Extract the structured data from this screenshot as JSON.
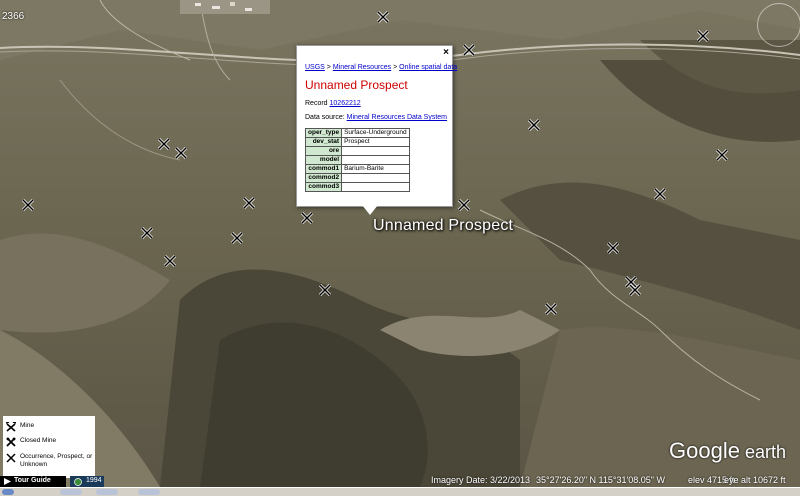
{
  "map": {
    "coord_fragment": "2366",
    "place_label": "Unnamed Prospect",
    "terrain_colors": {
      "base": "#6b6650",
      "ridge": "#4a4636",
      "valley": "#8a8470",
      "road": "#c8c4b6"
    }
  },
  "balloon": {
    "close_label": "×",
    "crumbs": {
      "link1": "USGS",
      "sep1": " > ",
      "link2": "Mineral Resources",
      "sep2": " > ",
      "link3": "Online spatial data"
    },
    "title": "Unnamed Prospect",
    "record_label": "Record ",
    "record_link": "10262212",
    "source_label": "Data source: ",
    "source_link": "Mineral Resources Data System",
    "table": [
      {
        "key": "oper_type",
        "value": "Surface-Underground"
      },
      {
        "key": "dev_stat",
        "value": "Prospect"
      },
      {
        "key": "ore",
        "value": ""
      },
      {
        "key": "model",
        "value": ""
      },
      {
        "key": "commod1",
        "value": "Barium-Barite"
      },
      {
        "key": "commod2",
        "value": ""
      },
      {
        "key": "commod3",
        "value": ""
      }
    ]
  },
  "legend": {
    "mine": "Mine",
    "closed_mine": "Closed Mine",
    "occurrence": "Occurrence, Prospect, or Unknown"
  },
  "logo": {
    "google": "Google",
    "earth": " earth"
  },
  "status": {
    "imagery_date": "Imagery Date: 3/22/2013",
    "coords": "35°27'26.20\" N  115°31'08.05\" W",
    "elev": "elev  4715 ft",
    "eye_alt": "eye alt  10672 ft"
  },
  "tour_guide": "Tour Guide",
  "year": "1994"
}
